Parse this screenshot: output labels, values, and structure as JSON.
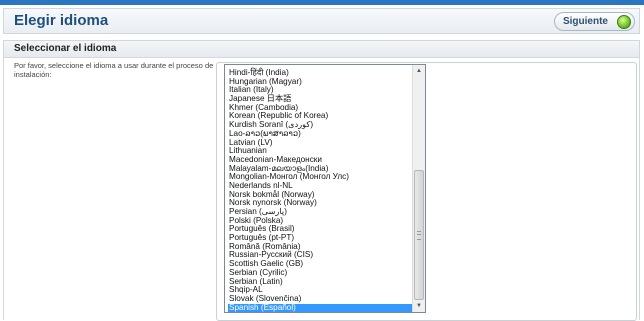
{
  "header": {
    "title": "Elegir idioma",
    "next_label": "Siguiente"
  },
  "panel": {
    "title": "Seleccionar el idioma",
    "instructions": "Por favor, seleccione el idioma a usar durante el proceso de instalación:"
  },
  "languages": {
    "items": [
      "Hindi-हिंदी (India)",
      "Hungarian (Magyar)",
      "Italian (Italy)",
      "Japanese 日本語",
      "Khmer (Cambodia)",
      "Korean (Republic of Korea)",
      "Kurdish Soranî (کوردی)",
      "Lao-ລາວ(ພາສາລາວ)",
      "Latvian (LV)",
      "Lithuanian",
      "Macedonian-Македонски",
      "Malayalam-മലയാളം(India)",
      "Mongolian-Монгол (Монгол Улс)",
      "Nederlands nl-NL",
      "Norsk bokmål (Norway)",
      "Norsk nynorsk (Norway)",
      "Persian (پارسی)",
      "Polski (Polska)",
      "Português (Brasil)",
      "Português (pt-PT)",
      "Română (România)",
      "Russian-Русский (CIS)",
      "Scottish Gaelic (GB)",
      "Serbian (Cyrilic)",
      "Serbian (Latin)",
      "Shqip-AL",
      "Slovak (Slovenčina)",
      "Spanish (Español)"
    ],
    "selected": "Spanish (Español)"
  },
  "icons": {
    "next": "go-arrow-icon"
  },
  "colors": {
    "accent": "#2b76c0",
    "selection": "#3399ff",
    "title": "#1f4f7f"
  }
}
